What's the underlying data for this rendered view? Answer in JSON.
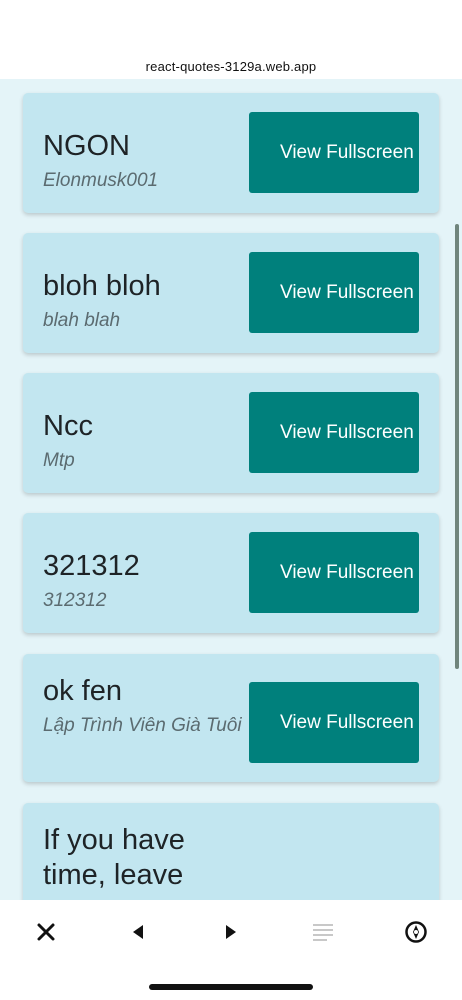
{
  "browser": {
    "url": "react-quotes-3129a.web.app"
  },
  "quotes": [
    {
      "quote": "NGON",
      "author": "Elonmusk001",
      "button_label": "View Fullscreen"
    },
    {
      "quote": "bloh bloh",
      "author": "blah blah",
      "button_label": "View Fullscreen"
    },
    {
      "quote": "Ncc",
      "author": "Mtp",
      "button_label": "View Fullscreen"
    },
    {
      "quote": "321312",
      "author": "312312",
      "button_label": "View Fullscreen"
    },
    {
      "quote": "ok fen",
      "author": "Lập Trình Viên Già Tuôi",
      "button_label": "View Fullscreen"
    },
    {
      "quote": "If you have time, leave",
      "author": "",
      "button_label": ""
    }
  ],
  "toolbar": {
    "icons": [
      "close-icon",
      "back-icon",
      "forward-icon",
      "reader-icon",
      "compass-icon"
    ],
    "colors": {
      "icon": "#111111",
      "disabled_icon": "#c8c8c8"
    }
  },
  "theme": {
    "page_background": "#e4f4f8",
    "card_background": "#c2e6f0",
    "button_background": "#00807c"
  }
}
